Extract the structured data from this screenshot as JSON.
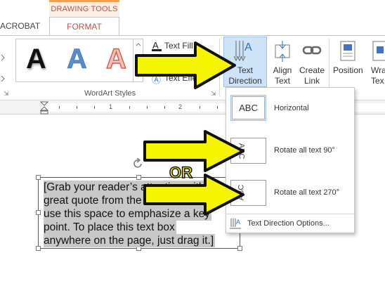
{
  "tabs": {
    "context_group": "DRAWING TOOLS",
    "acrobat": "ACROBAT",
    "format": "FORMAT"
  },
  "wordart": {
    "sample_letter": "A",
    "group_label": "WordArt Styles",
    "text_fill": "Text Fill",
    "text_effects": "Text Effe"
  },
  "ribbon": {
    "text_direction_line1": "Text",
    "text_direction_line2": "Direction",
    "align_line1": "Align",
    "align_line2": "Text",
    "link_line1": "Create",
    "link_line2": "Link",
    "position": "Position",
    "wrap_line1": "Wra",
    "wrap_line2": "Tex"
  },
  "ruler": {
    "numbers": [
      "1",
      "2"
    ]
  },
  "dropdown": {
    "horizontal_preview": "ABC",
    "horizontal": "Horizontal",
    "rotate90_preview": "ABC",
    "rotate90": "Rotate all text 90°",
    "rotate270_preview": "ABC",
    "rotate270": "Rotate all text 270°",
    "options": "Text Direction Options..."
  },
  "textbox": {
    "lines": [
      "[Grab your reader’s attention with a",
      "great quote from the document or",
      "use this space to emphasize a key",
      "point. To place this text box",
      "anywhere on the page, just drag it.]"
    ]
  },
  "annotation": {
    "or_label": "OR"
  },
  "colors": {
    "context_accent": "#c0504d",
    "selected_button": "#cde3f7",
    "arrow_fill": "#f5f500"
  }
}
